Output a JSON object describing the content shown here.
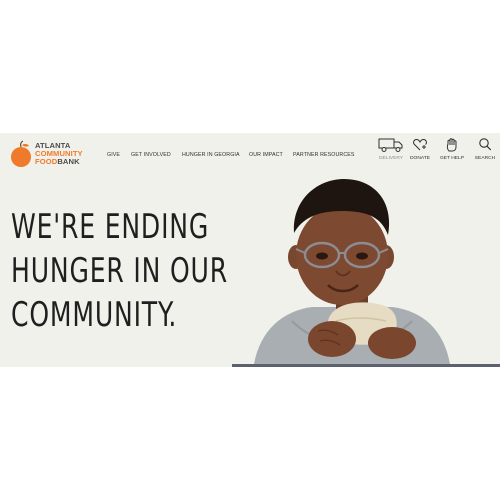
{
  "logo": {
    "lines": [
      "Atlanta",
      "Community",
      "Food",
      "Bank"
    ],
    "alt_name": "Atlanta Community Food Bank"
  },
  "nav": {
    "items": [
      "Give",
      "Get Involved",
      "Hunger in Georgia",
      "Our Impact",
      "Partner Resources"
    ]
  },
  "utility": {
    "delivery": "Delivery",
    "donate": "Donate",
    "get_help": "Get Help",
    "search": "Search"
  },
  "hero": {
    "lines": [
      "We're ending",
      "hunger in our",
      "community."
    ]
  },
  "colors": {
    "accent": "#f07a2b",
    "background": "#f1f1ec",
    "text": "#1f1f1f"
  }
}
